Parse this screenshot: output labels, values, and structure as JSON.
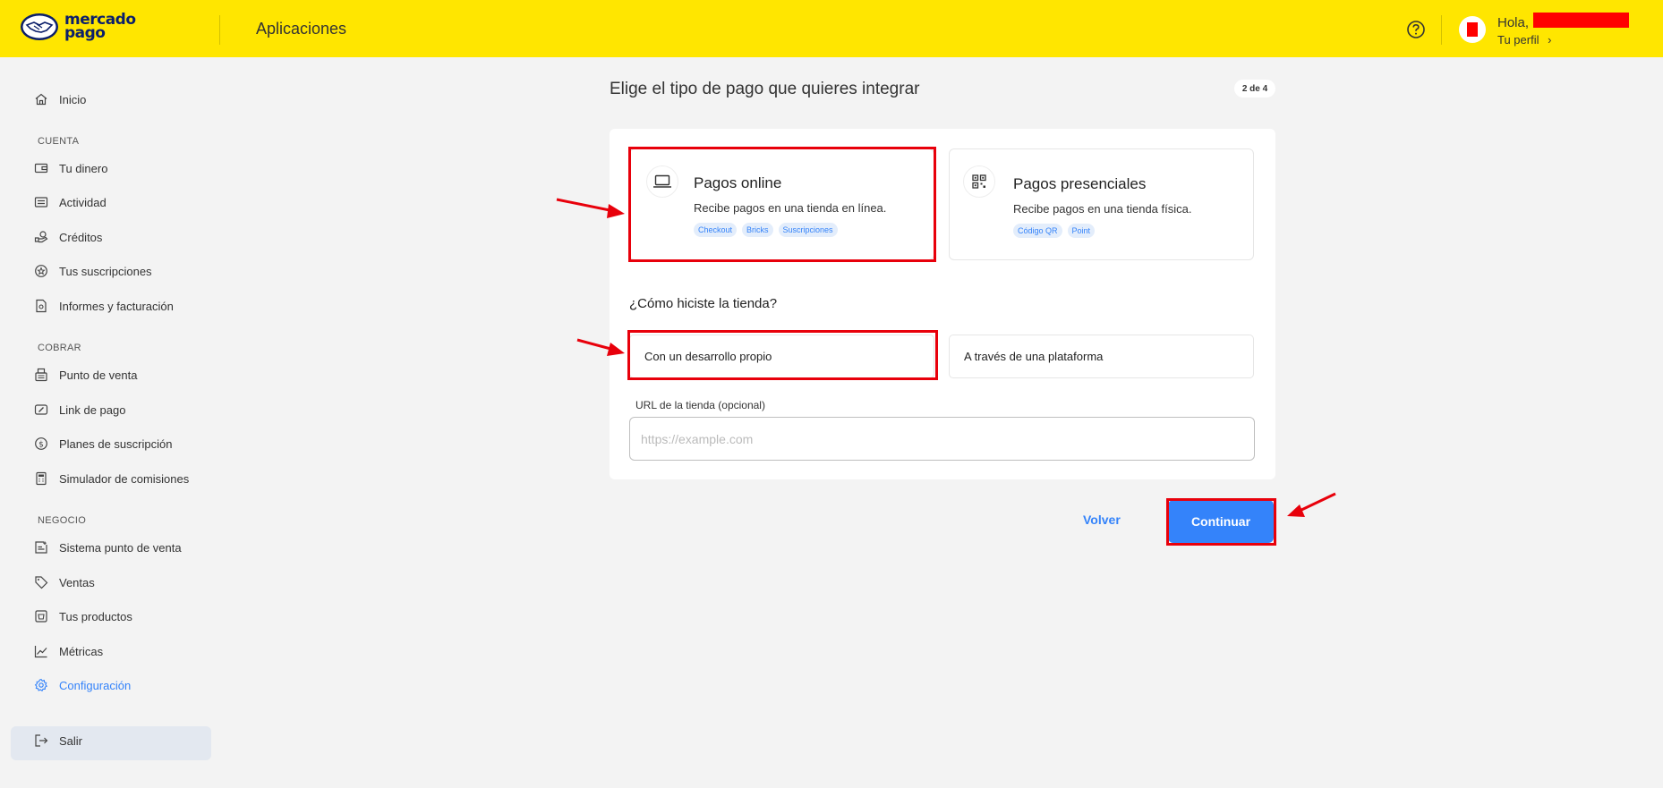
{
  "header": {
    "logo_line1": "mercado",
    "logo_line2": "pago",
    "title": "Aplicaciones",
    "greeting": "Hola,",
    "profile_link": "Tu perfil",
    "profile_chevron": "›"
  },
  "sidebar": {
    "home": {
      "label": "Inicio",
      "icon": "home-icon"
    },
    "sections": [
      {
        "title": "CUENTA",
        "items": [
          {
            "label": "Tu dinero",
            "icon": "wallet-icon"
          },
          {
            "label": "Actividad",
            "icon": "activity-icon"
          },
          {
            "label": "Créditos",
            "icon": "credits-icon"
          },
          {
            "label": "Tus suscripciones",
            "icon": "subscriptions-icon"
          },
          {
            "label": "Informes y facturación",
            "icon": "document-icon"
          }
        ]
      },
      {
        "title": "COBRAR",
        "items": [
          {
            "label": "Punto de venta",
            "icon": "pos-icon"
          },
          {
            "label": "Link de pago",
            "icon": "link-icon"
          },
          {
            "label": "Planes de suscripción",
            "icon": "dollar-circle-icon"
          },
          {
            "label": "Simulador de comisiones",
            "icon": "calculator-icon"
          }
        ]
      },
      {
        "title": "NEGOCIO",
        "items": [
          {
            "label": "Sistema punto de venta",
            "icon": "pos-system-icon"
          },
          {
            "label": "Ventas",
            "icon": "tag-icon"
          },
          {
            "label": "Tus productos",
            "icon": "products-icon"
          },
          {
            "label": "Métricas",
            "icon": "chart-icon"
          },
          {
            "label": "Configuración",
            "icon": "gear-icon",
            "active": true
          }
        ]
      }
    ],
    "logout": {
      "label": "Salir",
      "icon": "logout-icon"
    }
  },
  "main": {
    "title": "Elige el tipo de pago que quieres integrar",
    "step": "2 de 4",
    "options": [
      {
        "title": "Pagos online",
        "description": "Recibe pagos en una tienda en línea.",
        "icon": "laptop-icon",
        "tags": [
          "Checkout",
          "Bricks",
          "Suscripciones"
        ],
        "selected": true
      },
      {
        "title": "Pagos presenciales",
        "description": "Recibe pagos en una tienda física.",
        "icon": "qr-icon",
        "tags": [
          "Código QR",
          "Point"
        ],
        "selected": false
      }
    ],
    "question": "¿Cómo hiciste la tienda?",
    "choices": [
      {
        "label": "Con un desarrollo propio",
        "selected": true
      },
      {
        "label": "A través de una plataforma",
        "selected": false
      }
    ],
    "url_label": "URL de la tienda (opcional)",
    "url_placeholder": "https://example.com",
    "url_value": "",
    "back_label": "Volver",
    "continue_label": "Continuar"
  },
  "colors": {
    "header_bg": "#ffe600",
    "accent": "#3483fa",
    "annotation": "#e8000b"
  }
}
